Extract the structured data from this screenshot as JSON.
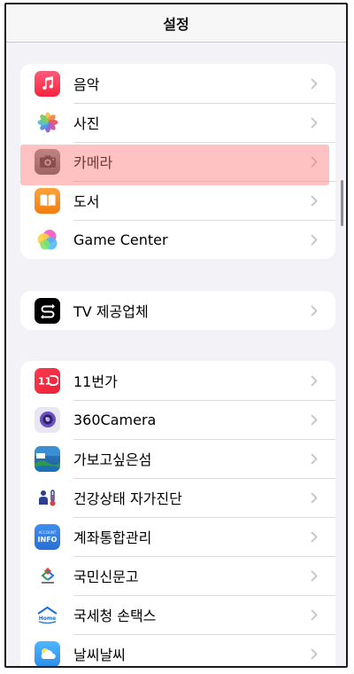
{
  "navbar": {
    "title": "설정"
  },
  "groups": [
    [
      {
        "label": "음악",
        "icon": "music-icon"
      },
      {
        "label": "사진",
        "icon": "photos-icon"
      },
      {
        "label": "카메라",
        "icon": "camera-icon"
      },
      {
        "label": "도서",
        "icon": "books-icon"
      },
      {
        "label": "Game Center",
        "icon": "game-center-icon"
      }
    ],
    [
      {
        "label": "TV 제공업체",
        "icon": "tv-provider-icon"
      }
    ],
    [
      {
        "label": "11번가",
        "icon": "11st-icon"
      },
      {
        "label": "360Camera",
        "icon": "360camera-icon"
      },
      {
        "label": "가보고싶은섬",
        "icon": "island-icon"
      },
      {
        "label": "건강상태 자가진단",
        "icon": "health-check-icon"
      },
      {
        "label": "계좌통합관리",
        "icon": "account-info-icon"
      },
      {
        "label": "국민신문고",
        "icon": "epeople-icon"
      },
      {
        "label": "국세청 손택스",
        "icon": "hometax-icon"
      },
      {
        "label": "날씨날씨",
        "icon": "weather-icon"
      }
    ]
  ],
  "highlighted_item": "카메라",
  "colors": {
    "music": "#fb3c5c",
    "camera": "#6b5a52",
    "books": "#f7931e",
    "tv": "#000000",
    "11st": "#f0303d",
    "account": "#2f7de1",
    "weather": "#3aa0f0",
    "highlight": "#ff7878"
  }
}
